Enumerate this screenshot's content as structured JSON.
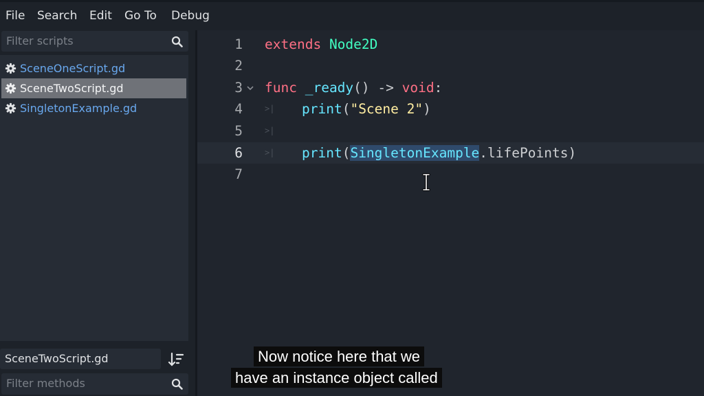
{
  "menu": {
    "items": [
      "File",
      "Search",
      "Edit",
      "Go To",
      "Debug"
    ]
  },
  "sidebar": {
    "filter_scripts_placeholder": "Filter scripts",
    "scripts": [
      {
        "name": "SceneOneScript.gd",
        "selected": false
      },
      {
        "name": "SceneTwoScript.gd",
        "selected": true
      },
      {
        "name": "SingletonExample.gd",
        "selected": false
      }
    ],
    "current_script": "SceneTwoScript.gd",
    "filter_methods_placeholder": "Filter methods"
  },
  "editor": {
    "line_numbers": [
      "1",
      "2",
      "3",
      "4",
      "5",
      "6",
      "7"
    ],
    "code": {
      "l1_extends": "extends",
      "l1_class": "Node2D",
      "l3_func": "func",
      "l3_name": "_ready",
      "l3_parens": "()",
      "l3_arrow": "->",
      "l3_void": "void",
      "l3_colon": ":",
      "l4_print": "print",
      "l4_open": "(",
      "l4_string": "\"Scene 2\"",
      "l4_close": ")",
      "l6_print": "print",
      "l6_open": "(",
      "l6_highlight": "SingletonExample",
      "l6_rest": ".lifePoints",
      "l6_close": ")"
    },
    "active_line": 6
  },
  "subtitles": {
    "line1": "Now notice here that we",
    "line2": "have an instance object called"
  },
  "colors": {
    "keyword": "#ff7085",
    "type": "#42ffc2",
    "string": "#ffeda1",
    "function": "#66e6ff",
    "script_link": "#69a8ee",
    "background": "#20252d"
  }
}
